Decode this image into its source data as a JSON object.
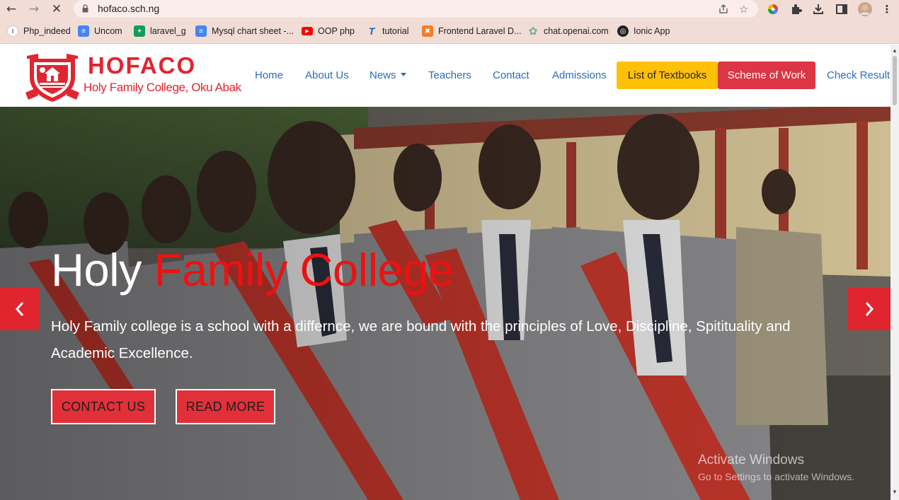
{
  "browser": {
    "url": "hofaco.sch.ng",
    "bookmarks": [
      {
        "label": "Php_indeed",
        "icon": "info-icon",
        "color": "#1a73e8"
      },
      {
        "label": "Uncom",
        "icon": "docs-icon",
        "color": "#4285f4"
      },
      {
        "label": "laravel_g",
        "icon": "sheets-icon",
        "color": "#0f9d58"
      },
      {
        "label": "Mysql chart sheet -...",
        "icon": "docs-icon",
        "color": "#4285f4"
      },
      {
        "label": "OOP php",
        "icon": "youtube-icon",
        "color": "#ff0000"
      },
      {
        "label": "tutorial",
        "icon": "tutorial-icon",
        "color": "#1565c0"
      },
      {
        "label": "Frontend Laravel D...",
        "icon": "xampp-icon",
        "color": "#fb7a24"
      },
      {
        "label": "chat.openai.com",
        "icon": "openai-icon",
        "color": "#74aa9c"
      },
      {
        "label": "Ionic App",
        "icon": "globe-icon",
        "color": "#202124"
      }
    ]
  },
  "site": {
    "logo_name": "HOFACO",
    "logo_tagline": "Holy Family College, Oku Abak",
    "nav": {
      "home": "Home",
      "about": "About Us",
      "news": "News",
      "teachers": "Teachers",
      "contact": "Contact",
      "admissions": "Admissions",
      "textbooks": "List of Textbooks",
      "scheme": "Scheme of Work",
      "results": "Check Results"
    },
    "hero": {
      "title_white": "Holy",
      "title_red": "Family College",
      "text": "Holy Family college is a school with a differnce, we are bound with the principles of Love, Discipline, Spitituality and Academic Excellence.",
      "contact_button": "CONTACT US",
      "read_more_button": "READ MORE"
    },
    "colors": {
      "brand_red": "#e0252f",
      "link_blue": "#2a6db5",
      "warning_yellow": "#ffc107",
      "danger_red": "#dc3545"
    }
  },
  "os_watermark": {
    "line1": "Activate Windows",
    "line2": "Go to Settings to activate Windows."
  }
}
